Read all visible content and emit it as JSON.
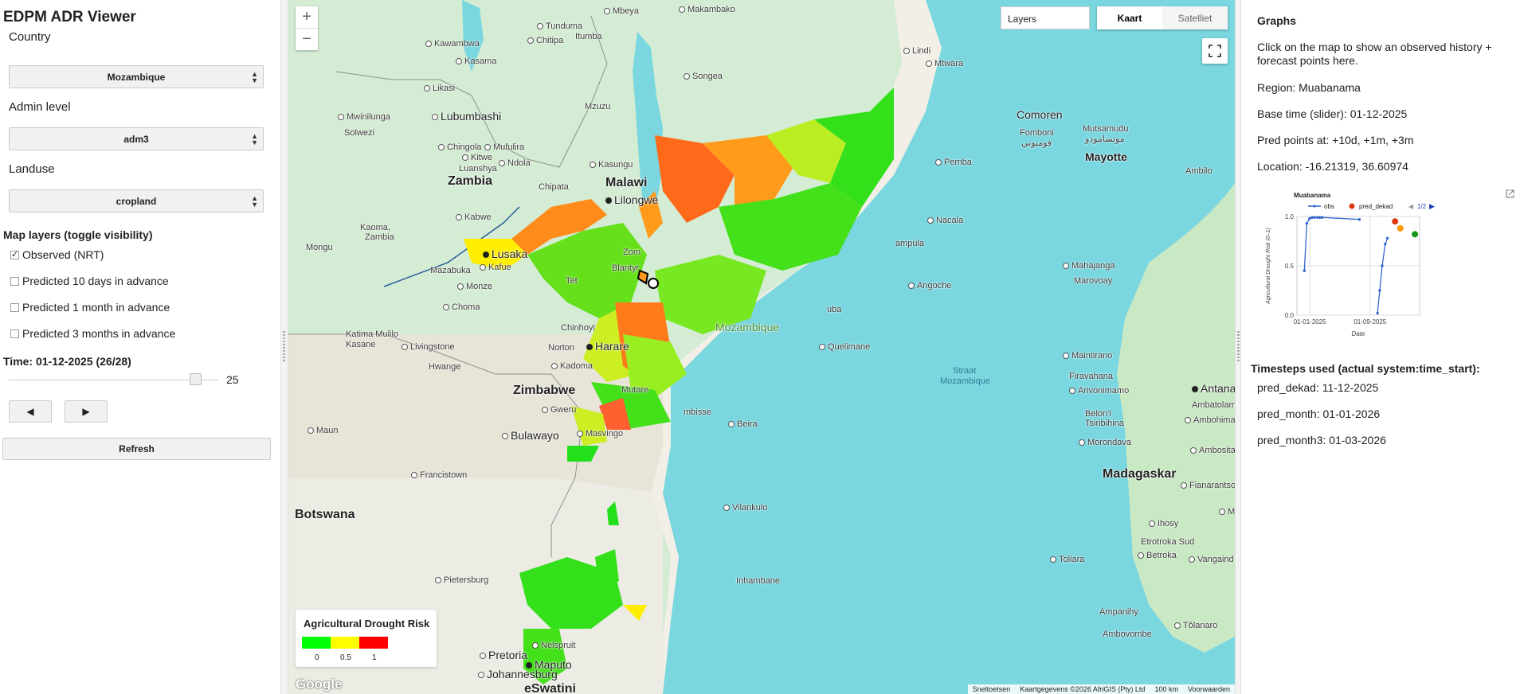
{
  "app": {
    "title": "EDPM ADR Viewer"
  },
  "controls": {
    "country_label": "Country",
    "country_value": "Mozambique",
    "admin_label": "Admin level",
    "admin_value": "adm3",
    "landuse_label": "Landuse",
    "landuse_value": "cropland",
    "layers_heading": "Map layers (toggle visibility)",
    "layers": [
      {
        "label": "Observed (NRT)",
        "checked": true
      },
      {
        "label": "Predicted 10 days in advance",
        "checked": false
      },
      {
        "label": "Predicted 1 month in advance",
        "checked": false
      },
      {
        "label": "Predicted 3 months in advance",
        "checked": false
      }
    ],
    "time_label": "Time: 01-12-2025 (26/28)",
    "slider_value": "25",
    "slider_fraction": 0.89,
    "prev_label": "◀",
    "next_label": "▶",
    "refresh_label": "Refresh"
  },
  "map": {
    "zoom_in": "+",
    "zoom_out": "−",
    "layers_input": "Layers",
    "type_map": "Kaart",
    "type_satellite": "Satelliet",
    "legend": {
      "title": "Agricultural Drought Risk",
      "ticks": [
        "0",
        "0.5",
        "1"
      ],
      "colors": [
        "#00ff00",
        "#ffff00",
        "#ff0000"
      ]
    },
    "google": "Google",
    "attribution": {
      "shortcuts": "Sneltoetsen",
      "data": "Kaartgegevens ©2026 AfriGIS (Pty) Ltd",
      "scale": "100 km",
      "terms": "Voorwaarden"
    },
    "labels": {
      "mbeya": "Mbeya",
      "makambako": "Makambako",
      "tunduma": "Tunduma",
      "chitipa": "Chitipa",
      "itumba": "Itumba",
      "kawambwa": "Kawambwa",
      "kasama": "Kasama",
      "lindi": "Lindi",
      "mtwara": "Mtwara",
      "songea": "Songea",
      "likasi": "Likasi",
      "mwinilunga": "Mwinilunga",
      "lubumbashi": "Lubumbashi",
      "mzuzu": "Mzuzu",
      "comoros": "Comoren",
      "fomboni": "Fomboni",
      "fomboni_ar": "فومبوني",
      "mutsamudu": "Mutsamudu",
      "mutsamudu_ar": "موتسامودو",
      "mayotte": "Mayotte",
      "solwezi": "Solwezi",
      "chingola": "Chingola",
      "mufulira": "Mufulira",
      "kitwe": "Kitwe",
      "ndola": "Ndola",
      "luanshya": "Luanshya",
      "kasungu": "Kasungu",
      "pemba": "Pemba",
      "ambilo": "Ambilo",
      "zambia": "Zambia",
      "chipata": "Chipata",
      "malawi": "Malawi",
      "lilongwe": "Lilongwe",
      "kabwe": "Kabwe",
      "nacala": "Nacala",
      "kaoma": "Kaoma,",
      "zambia2": "Zambia",
      "lusaka": "Lusaka",
      "mongu": "Mongu",
      "zomba": "Zom",
      "blantyre": "Blantyr",
      "nampula": "ampula",
      "mahajanga": "Mahajanga",
      "mazabuka": "Mazabuka",
      "kafue": "Kafue",
      "monze": "Monze",
      "tete": "Tet",
      "marovoay": "Marovoay",
      "angoche": "Angoche",
      "choma": "Choma",
      "mocuba": "uba",
      "katima": "Katima Mulilo",
      "kasane": "Kasane",
      "livingstone": "Livingstone",
      "chinhoyi": "Chinhoyi",
      "norton": "Norton",
      "harare": "Harare",
      "mozambique": "Mozambique",
      "quelimane": "Quelimane",
      "hwange": "Hwange",
      "kadoma": "Kadoma",
      "maintirano": "Maintirano",
      "straat": "Straat",
      "mozambique2": "Mozambique",
      "fiavahana": "Firavahana",
      "antana": "Antana",
      "zimbabwe": "Zimbabwe",
      "mutare": "Mutare",
      "arivonimamo": "Arivonimamo",
      "ambatolam": "Ambatolam",
      "belon": "Belon'i",
      "tsiribihina": "Tsiribihina",
      "ambohiman": "Ambohiman",
      "maun": "Maun",
      "bulawayo": "Bulawayo",
      "gweru": "Gweru",
      "masvingo": "Masvingo",
      "dombe": "mbisse",
      "beira": "Beira",
      "morondava": "Morondava",
      "ambosita": "Ambosita",
      "francistown": "Francistown",
      "madagascar": "Madagaskar",
      "fianarantsoa": "Fianarantsoa",
      "botswana": "Botswana",
      "vilankulo": "Vilankulo",
      "mana": "Mana",
      "ihosy": "Ihosy",
      "etrotroka": "Etrotroka Sud",
      "betroka": "Betroka",
      "toliara": "Toliara",
      "vangaind": "Vangaind",
      "inhambane": "Inhambane",
      "pietersburg": "Pietersburg",
      "ampanihy": "Ampanihy",
      "tolanaro": "Tôlanaro",
      "ambovombe": "Ambovombe",
      "nelspruit": "Nelspruit",
      "pretoria": "Pretoria",
      "maputo": "Maputo",
      "johannesburg": "Johannesburg",
      "eswatini": "eSwatini"
    }
  },
  "graphs": {
    "heading": "Graphs",
    "instructions": "Click on the map to show an observed history + forecast points here.",
    "region": "Region: Muabanama",
    "base_time": "Base time (slider): 01-12-2025",
    "pred_points": "Pred points at: +10d, +1m, +3m",
    "location": "Location: -16.21319, 36.60974",
    "timesteps_heading": "Timesteps used (actual system:time_start):",
    "timesteps": [
      "pred_dekad:  11-12-2025",
      "pred_month:  01-01-2026",
      "pred_month3: 01-03-2026"
    ]
  },
  "chart_data": {
    "type": "scatter",
    "title": "Muabanama",
    "xlabel": "Date",
    "ylabel": "Agricultural Drought Risk (0–1)",
    "ylim": [
      0,
      1
    ],
    "xlim": [
      "2024-11-10",
      "2026-03-20"
    ],
    "x_ticks": [
      "01-01-2025",
      "01-09-2025"
    ],
    "y_ticks": [
      "0.0",
      "0.5",
      "1.0"
    ],
    "legend": [
      "obs",
      "pred_dekad"
    ],
    "legend_page": "1/2",
    "series": [
      {
        "name": "obs",
        "color": "#3366cc",
        "kind": "line",
        "points": [
          [
            "2024-12-10",
            0.45
          ],
          [
            "2024-12-20",
            0.93
          ],
          [
            "2024-12-31",
            0.98
          ],
          [
            "2025-01-10",
            0.99
          ],
          [
            "2025-01-20",
            0.99
          ],
          [
            "2025-02-01",
            0.99
          ],
          [
            "2025-02-10",
            0.99
          ],
          [
            "2025-02-20",
            0.99
          ],
          [
            "2025-07-20",
            0.97
          ],
          [
            "__gap__",
            null
          ],
          [
            "2025-10-01",
            0.02
          ],
          [
            "2025-10-10",
            0.25
          ],
          [
            "2025-10-20",
            0.5
          ],
          [
            "2025-11-01",
            0.72
          ],
          [
            "2025-11-10",
            0.78
          ]
        ]
      },
      {
        "name": "pred_dekad",
        "color": "#dc3912",
        "kind": "point",
        "points": [
          [
            "2025-12-11",
            0.95
          ]
        ]
      },
      {
        "name": "pred_month",
        "color": "#ff9900",
        "kind": "point",
        "points": [
          [
            "2026-01-01",
            0.88
          ]
        ]
      },
      {
        "name": "pred_month3",
        "color": "#109618",
        "kind": "point",
        "points": [
          [
            "2026-03-01",
            0.82
          ]
        ]
      }
    ]
  }
}
